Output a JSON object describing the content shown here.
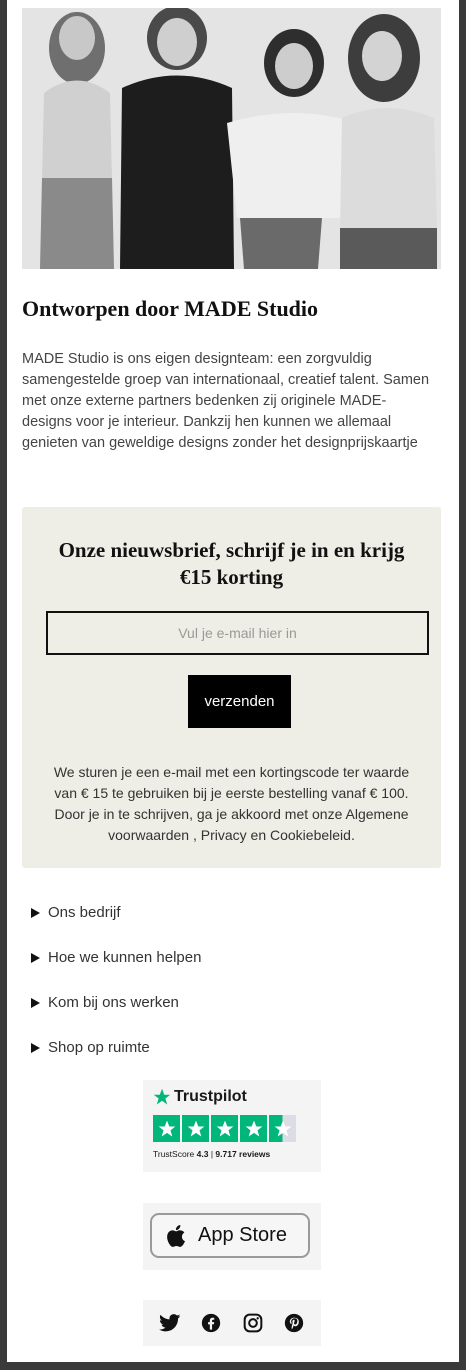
{
  "hero": {
    "alt": "MADE Studio team"
  },
  "about": {
    "title": "Ontworpen door MADE Studio",
    "text": "MADE Studio is ons eigen designteam: een zorgvuldig samengestelde groep van internationaal, creatief talent. Samen met onze externe partners bedenken zij originele MADE-designs voor je interieur. Dankzij hen kunnen we allemaal genieten van geweldige designs zonder het designprijskaartje"
  },
  "newsletter": {
    "title": "Onze nieuwsbrief, schrijf je in en krijg €15 korting",
    "email_placeholder": "Vul je e-mail hier in",
    "email_value": "",
    "submit_label": "verzenden",
    "note": "We sturen je een e-mail met een kortingscode ter waarde van € 15 te gebruiken bij je eerste bestelling vanaf € 100. Door je in te schrijven, ga je akkoord met onze Algemene voorwaarden , Privacy en Cookiebeleid."
  },
  "footer": {
    "items": [
      {
        "label": "Ons bedrijf"
      },
      {
        "label": "Hoe we kunnen helpen"
      },
      {
        "label": "Kom bij ons werken"
      },
      {
        "label": "Shop op ruimte"
      }
    ]
  },
  "trustpilot": {
    "brand": "Trustpilot",
    "rating_stars": 4.5,
    "score_label": "TrustScore",
    "score": "4.3",
    "reviews": "9.717 reviews"
  },
  "appstore": {
    "label": "App Store",
    "icon": "apple-icon"
  },
  "social": {
    "icons": [
      "twitter-icon",
      "facebook-icon",
      "instagram-icon",
      "pinterest-icon"
    ]
  },
  "colors": {
    "newsletter_bg": "#eeede6",
    "trustpilot_green": "#00b67a",
    "button_bg": "#000000"
  }
}
